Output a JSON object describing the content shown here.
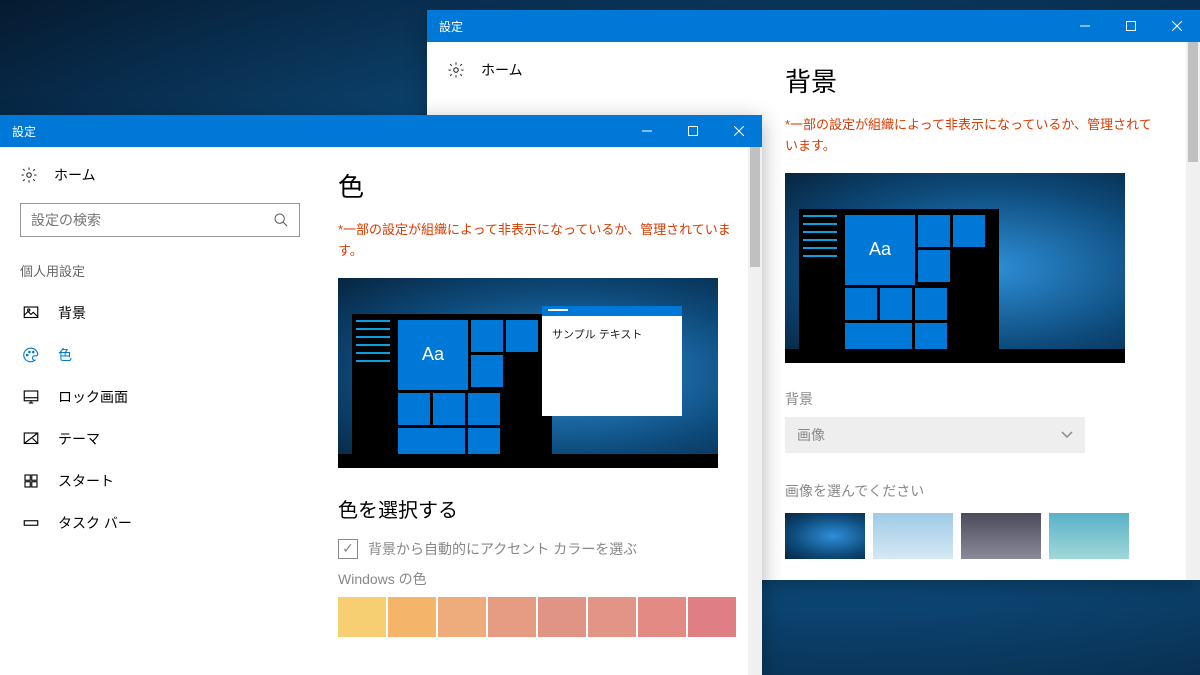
{
  "window1": {
    "title": "設定",
    "home": "ホーム",
    "search_placeholder": "設定の検索",
    "section_label": "個人用設定",
    "nav": [
      {
        "label": "背景",
        "active": false
      },
      {
        "label": "色",
        "active": true
      },
      {
        "label": "ロック画面",
        "active": false
      },
      {
        "label": "テーマ",
        "active": false
      },
      {
        "label": "スタート",
        "active": false
      },
      {
        "label": "タスク バー",
        "active": false
      }
    ],
    "content": {
      "title": "色",
      "warning": "*一部の設定が組織によって非表示になっているか、管理されています。",
      "preview_sample": "サンプル テキスト",
      "preview_aa": "Aa",
      "section_choose": "色を選択する",
      "checkbox_label": "背景から自動的にアクセント カラーを選ぶ",
      "windows_color_label": "Windows の色",
      "swatches": [
        "#f6cf73",
        "#f4b56a",
        "#eeac7d",
        "#e69b83",
        "#df9485",
        "#e29486",
        "#e38a84",
        "#df7f84"
      ]
    }
  },
  "window2": {
    "title": "設定",
    "home": "ホーム",
    "content": {
      "title": "背景",
      "warning": "*一部の設定が組織によって非表示になっているか、管理されています。",
      "preview_aa": "Aa",
      "bg_label": "背景",
      "bg_value": "画像",
      "choose_image_label": "画像を選んでください",
      "thumbs": [
        "radial-gradient(ellipse at 60% 50%, #2e8fd8 0%, #0d4a7a 60%, #072540 100%)",
        "linear-gradient(#9fcae8,#d5e8f2)",
        "linear-gradient(#4a4a5a,#8a8a9a)",
        "linear-gradient(#5ab0c8,#a0d8d8)"
      ]
    }
  }
}
